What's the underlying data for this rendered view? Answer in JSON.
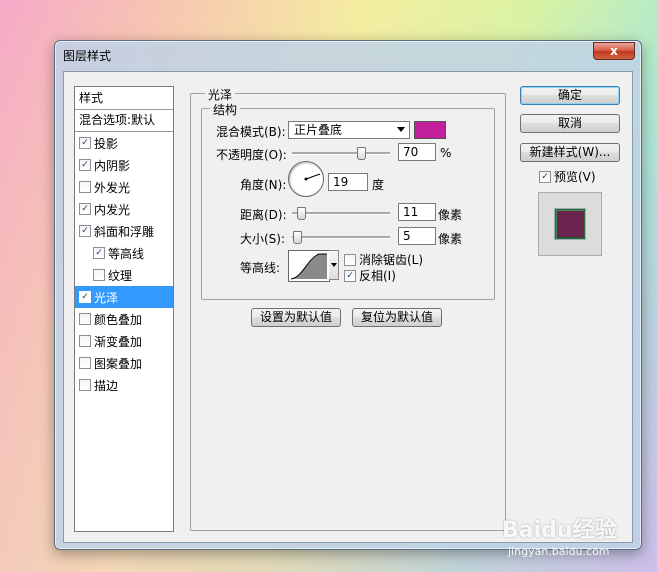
{
  "window": {
    "title": "图层样式",
    "close_label": "x"
  },
  "styles_panel": {
    "header": "样式",
    "blend_options": "混合选项:默认",
    "items": [
      {
        "label": "投影",
        "checked": true,
        "sub": false,
        "selected": false
      },
      {
        "label": "内阴影",
        "checked": true,
        "sub": false,
        "selected": false
      },
      {
        "label": "外发光",
        "checked": false,
        "sub": false,
        "selected": false
      },
      {
        "label": "内发光",
        "checked": true,
        "sub": false,
        "selected": false
      },
      {
        "label": "斜面和浮雕",
        "checked": true,
        "sub": false,
        "selected": false
      },
      {
        "label": "等高线",
        "checked": true,
        "sub": true,
        "selected": false
      },
      {
        "label": "纹理",
        "checked": false,
        "sub": true,
        "selected": false
      },
      {
        "label": "光泽",
        "checked": true,
        "sub": false,
        "selected": true
      },
      {
        "label": "颜色叠加",
        "checked": false,
        "sub": false,
        "selected": false
      },
      {
        "label": "渐变叠加",
        "checked": false,
        "sub": false,
        "selected": false
      },
      {
        "label": "图案叠加",
        "checked": false,
        "sub": false,
        "selected": false
      },
      {
        "label": "描边",
        "checked": false,
        "sub": false,
        "selected": false
      }
    ]
  },
  "satin": {
    "group_title": "光泽",
    "structure_title": "结构",
    "blend_mode_label": "混合模式(B):",
    "blend_mode_value": "正片叠底",
    "blend_color": "#c2209a",
    "opacity_label": "不透明度(O):",
    "opacity_value": "70",
    "opacity_unit": "%",
    "angle_label": "角度(N):",
    "angle_value": "19",
    "angle_unit": "度",
    "distance_label": "距离(D):",
    "distance_value": "11",
    "distance_unit": "像素",
    "size_label": "大小(S):",
    "size_value": "5",
    "size_unit": "像素",
    "contour_label": "等高线:",
    "anti_alias_label": "消除锯齿(L)",
    "anti_alias_checked": false,
    "invert_label": "反相(I)",
    "invert_checked": true,
    "set_default_label": "设置为默认值",
    "reset_default_label": "复位为默认值"
  },
  "actions": {
    "ok_label": "确定",
    "cancel_label": "取消",
    "new_style_label": "新建样式(W)...",
    "preview_label": "预览(V)",
    "preview_checked": true
  },
  "watermark": {
    "brand": "Baidu经验",
    "url": "jingyan.baidu.com"
  }
}
